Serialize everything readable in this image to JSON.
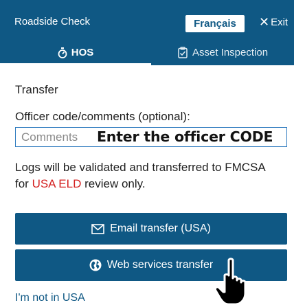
{
  "header": {
    "title": "Roadside Check",
    "language_button": "Français",
    "exit_label": "Exit"
  },
  "tabs": [
    {
      "label": "HOS",
      "icon": "stopwatch-icon",
      "active": true
    },
    {
      "label": "Asset Inspection",
      "icon": "clipboard-icon",
      "active": false
    }
  ],
  "transfer": {
    "section_title": "Transfer",
    "officer_label": "Officer code/comments (optional):",
    "comments_placeholder": "Comments",
    "overlay_instruction": "Enter the officer CODE",
    "note_before": "Logs will be validated and transferred to FMCSA for ",
    "note_highlight": "USA ELD",
    "note_after": " review only.",
    "email_button": "Email transfer (USA)",
    "web_button": "Web services transfer",
    "not_in_usa_link": "I'm not in USA"
  },
  "colors": {
    "primary": "#0f5884",
    "highlight_red": "#d42020",
    "input_border": "#2f7bbf"
  }
}
